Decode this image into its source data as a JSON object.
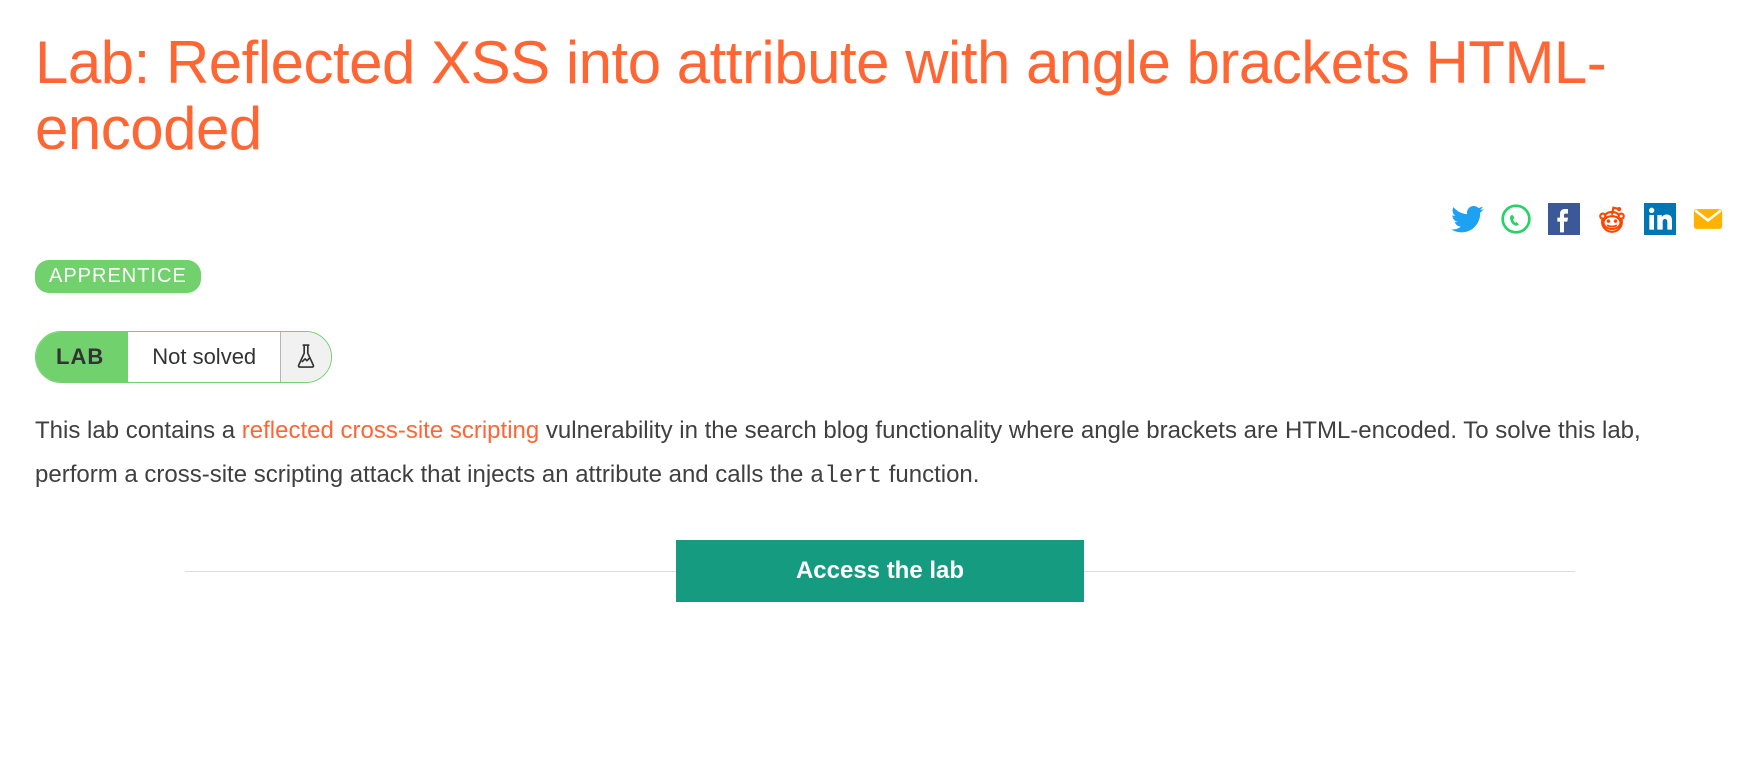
{
  "title": "Lab: Reflected XSS into attribute with angle brackets HTML-encoded",
  "difficulty_badge": "APPRENTICE",
  "lab_status": {
    "label": "LAB",
    "status": "Not solved"
  },
  "description": {
    "part1": "This lab contains a ",
    "link_text": "reflected cross-site scripting",
    "part2": " vulnerability in the search blog functionality where angle brackets are HTML-encoded. To solve this lab, perform a cross-site scripting attack that injects an attribute and calls the ",
    "code": "alert",
    "part3": " function."
  },
  "access_button": "Access the lab",
  "share": {
    "twitter": "twitter",
    "whatsapp": "whatsapp",
    "facebook": "facebook",
    "reddit": "reddit",
    "linkedin": "linkedin",
    "email": "email"
  }
}
